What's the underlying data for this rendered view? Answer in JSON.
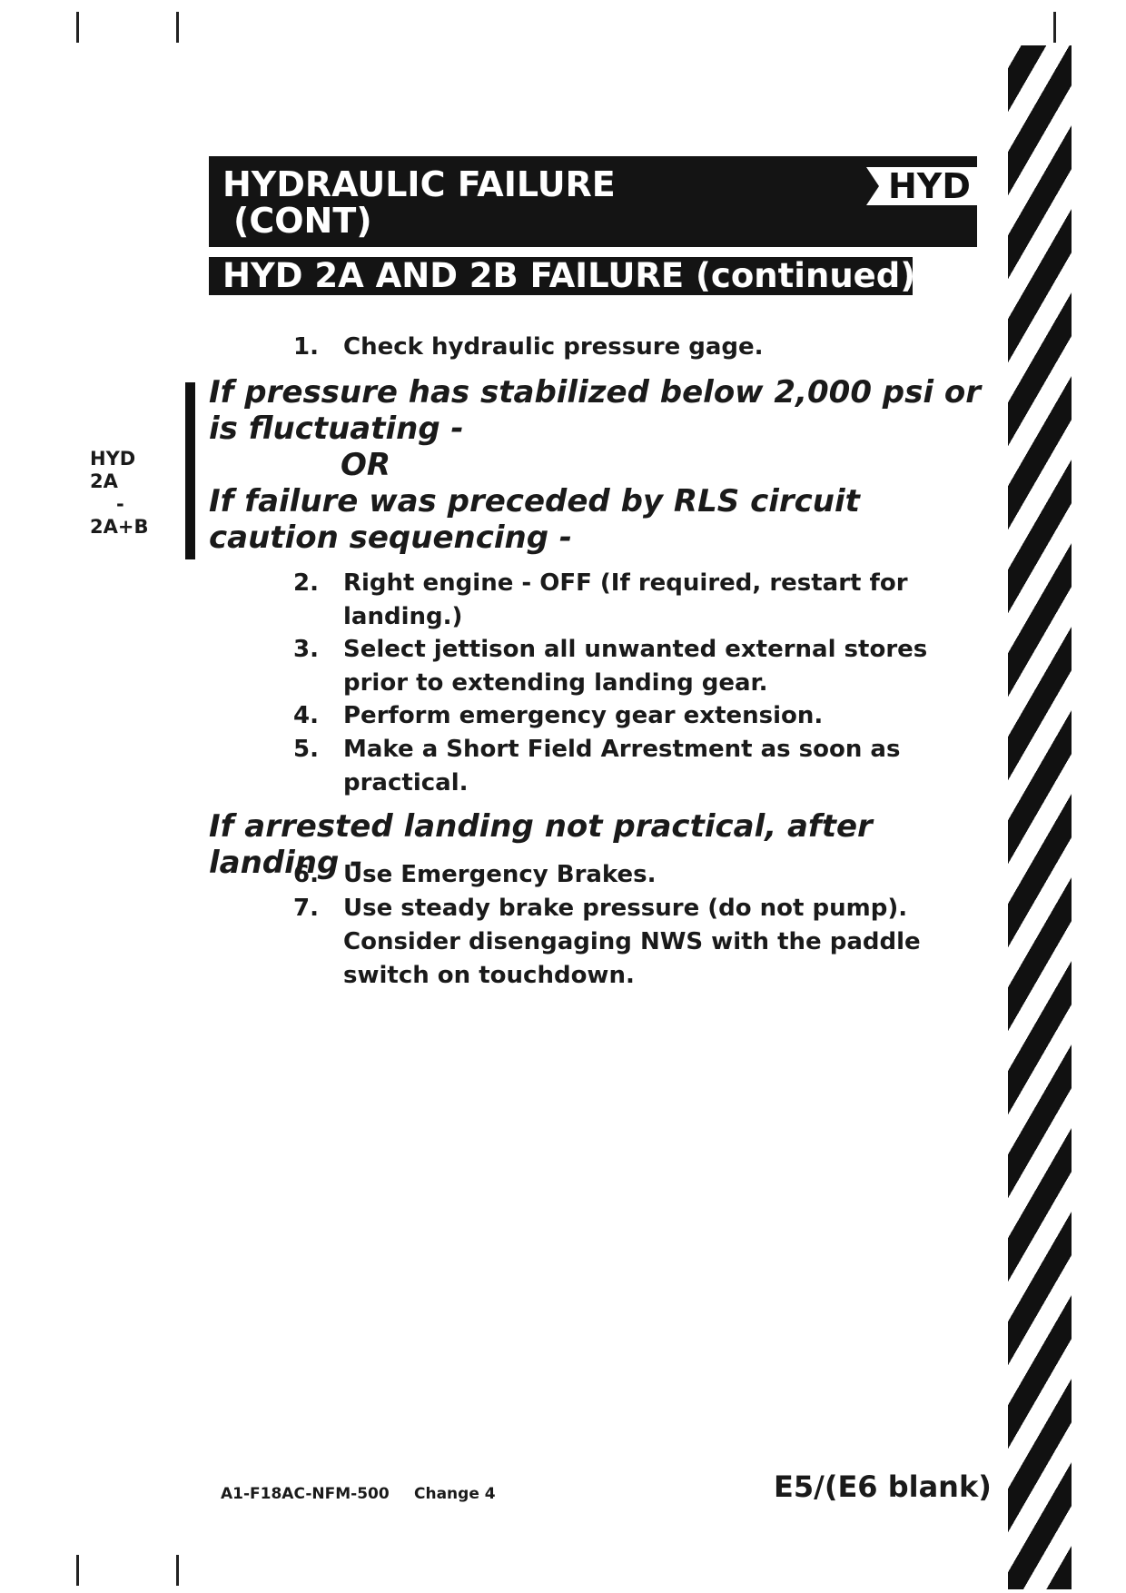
{
  "header": {
    "title_line1": "HYDRAULIC FAILURE",
    "title_line2": "(CONT)",
    "tab_label": "HYD",
    "subtitle": "HYD 2A AND 2B FAILURE (continued)"
  },
  "margin_note": {
    "line1": "HYD",
    "line2": "2A",
    "line3": "-",
    "line4": "2A+B"
  },
  "steps": [
    {
      "num": "1.",
      "text": "Check hydraulic pressure gage."
    },
    {
      "num": "2.",
      "text": "Right engine - OFF (If required, restart for landing.)"
    },
    {
      "num": "3.",
      "text": "Select jettison all unwanted external stores prior to extending landing gear."
    },
    {
      "num": "4.",
      "text": "Perform emergency gear extension."
    },
    {
      "num": "5.",
      "text": "Make a Short Field Arrestment as soon as practical."
    },
    {
      "num": "6.",
      "text": "Use Emergency Brakes."
    },
    {
      "num": "7.",
      "text": "Use steady brake pressure (do not pump). Consider disengaging NWS with the paddle switch on touchdown."
    }
  ],
  "conditions": {
    "c1": "If pressure has stabilized below 2,000 psi or is fluctuating -",
    "or": "OR",
    "c2": "If failure was preceded by RLS circuit caution sequencing -",
    "c3": "If arrested landing not practical, after landing -"
  },
  "footer": {
    "doc_id": "A1-F18AC-NFM-500",
    "change": "Change 4",
    "page": "E5/(E6 blank)"
  }
}
